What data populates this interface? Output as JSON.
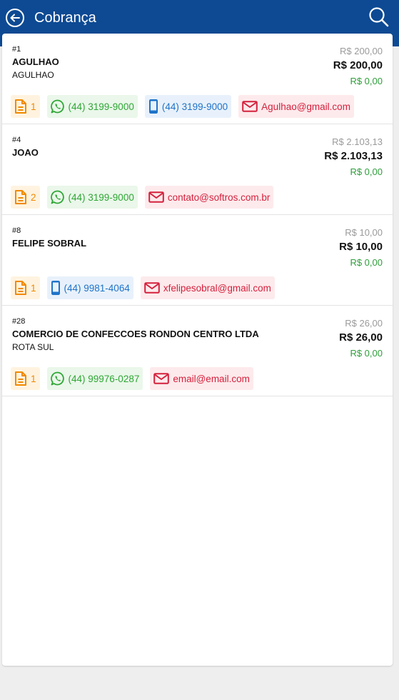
{
  "header": {
    "title": "Cobrança",
    "background": "#0d4a93"
  },
  "colors": {
    "doc": "#f08a00",
    "whatsapp": "#2ea635",
    "phone": "#1e73c8",
    "email": "#d4213d",
    "paid_value": "#2e9e3a"
  },
  "items": [
    {
      "id": "#1",
      "name": "AGULHAO",
      "subtitle": "AGULHAO",
      "amount_original": "R$ 200,00",
      "amount_due": "R$ 200,00",
      "amount_paid": "R$ 0,00",
      "chips": [
        {
          "type": "doc",
          "icon": "document-icon",
          "label": "1"
        },
        {
          "type": "wa",
          "icon": "whatsapp-icon",
          "label": "(44) 3199-9000"
        },
        {
          "type": "phone",
          "icon": "smartphone-icon",
          "label": "(44) 3199-9000"
        },
        {
          "type": "mail",
          "icon": "email-icon",
          "label": "Agulhao@gmail.com"
        }
      ]
    },
    {
      "id": "#4",
      "name": "JOAO",
      "subtitle": "",
      "amount_original": "R$ 2.103,13",
      "amount_due": "R$ 2.103,13",
      "amount_paid": "R$ 0,00",
      "chips": [
        {
          "type": "doc",
          "icon": "document-icon",
          "label": "2"
        },
        {
          "type": "wa",
          "icon": "whatsapp-icon",
          "label": "(44) 3199-9000"
        },
        {
          "type": "mail",
          "icon": "email-icon",
          "label": "contato@softros.com.br"
        }
      ]
    },
    {
      "id": "#8",
      "name": "FELIPE SOBRAL",
      "subtitle": "",
      "amount_original": "R$ 10,00",
      "amount_due": "R$ 10,00",
      "amount_paid": "R$ 0,00",
      "chips": [
        {
          "type": "doc",
          "icon": "document-icon",
          "label": "1"
        },
        {
          "type": "phone",
          "icon": "smartphone-icon",
          "label": "(44) 9981-4064"
        },
        {
          "type": "mail",
          "icon": "email-icon",
          "label": "xfelipesobral@gmail.com"
        }
      ]
    },
    {
      "id": "#28",
      "name": "COMERCIO DE CONFECCOES RONDON CENTRO LTDA",
      "subtitle": "ROTA SUL",
      "amount_original": "R$ 26,00",
      "amount_due": "R$ 26,00",
      "amount_paid": "R$ 0,00",
      "chips": [
        {
          "type": "doc",
          "icon": "document-icon",
          "label": "1"
        },
        {
          "type": "wa",
          "icon": "whatsapp-icon",
          "label": "(44) 99976-0287"
        },
        {
          "type": "mail",
          "icon": "email-icon",
          "label": "email@email.com"
        }
      ]
    }
  ]
}
